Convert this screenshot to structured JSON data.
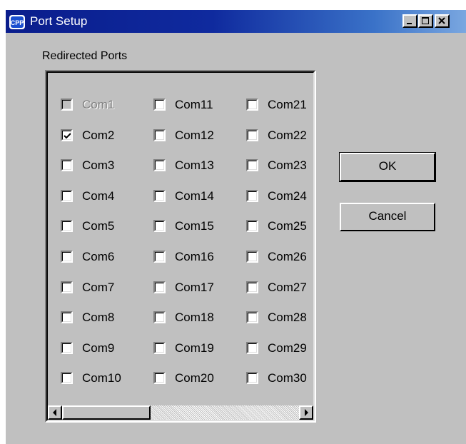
{
  "window": {
    "title": "Port Setup"
  },
  "group": {
    "caption": "Redirected Ports"
  },
  "ports": [
    {
      "label": "Com1",
      "checked": false,
      "disabled": true
    },
    {
      "label": "Com2",
      "checked": true,
      "disabled": false
    },
    {
      "label": "Com3",
      "checked": false,
      "disabled": false
    },
    {
      "label": "Com4",
      "checked": false,
      "disabled": false
    },
    {
      "label": "Com5",
      "checked": false,
      "disabled": false
    },
    {
      "label": "Com6",
      "checked": false,
      "disabled": false
    },
    {
      "label": "Com7",
      "checked": false,
      "disabled": false
    },
    {
      "label": "Com8",
      "checked": false,
      "disabled": false
    },
    {
      "label": "Com9",
      "checked": false,
      "disabled": false
    },
    {
      "label": "Com10",
      "checked": false,
      "disabled": false
    },
    {
      "label": "Com11",
      "checked": false,
      "disabled": false
    },
    {
      "label": "Com12",
      "checked": false,
      "disabled": false
    },
    {
      "label": "Com13",
      "checked": false,
      "disabled": false
    },
    {
      "label": "Com14",
      "checked": false,
      "disabled": false
    },
    {
      "label": "Com15",
      "checked": false,
      "disabled": false
    },
    {
      "label": "Com16",
      "checked": false,
      "disabled": false
    },
    {
      "label": "Com17",
      "checked": false,
      "disabled": false
    },
    {
      "label": "Com18",
      "checked": false,
      "disabled": false
    },
    {
      "label": "Com19",
      "checked": false,
      "disabled": false
    },
    {
      "label": "Com20",
      "checked": false,
      "disabled": false
    },
    {
      "label": "Com21",
      "checked": false,
      "disabled": false
    },
    {
      "label": "Com22",
      "checked": false,
      "disabled": false
    },
    {
      "label": "Com23",
      "checked": false,
      "disabled": false
    },
    {
      "label": "Com24",
      "checked": false,
      "disabled": false
    },
    {
      "label": "Com25",
      "checked": false,
      "disabled": false
    },
    {
      "label": "Com26",
      "checked": false,
      "disabled": false
    },
    {
      "label": "Com27",
      "checked": false,
      "disabled": false
    },
    {
      "label": "Com28",
      "checked": false,
      "disabled": false
    },
    {
      "label": "Com29",
      "checked": false,
      "disabled": false
    },
    {
      "label": "Com30",
      "checked": false,
      "disabled": false
    }
  ],
  "buttons": {
    "ok": "OK",
    "cancel": "Cancel"
  },
  "icons": {
    "app": "app-icon",
    "minimize": "minimize-icon",
    "maximize": "maximize-icon",
    "close": "close-icon",
    "scroll_left": "arrow-left-icon",
    "scroll_right": "arrow-right-icon",
    "check": "check-icon"
  },
  "colors": {
    "title_start": "#0a1d8c",
    "title_end": "#7aa7e0",
    "face": "#c0c0c0",
    "disabled_text": "#808080"
  }
}
